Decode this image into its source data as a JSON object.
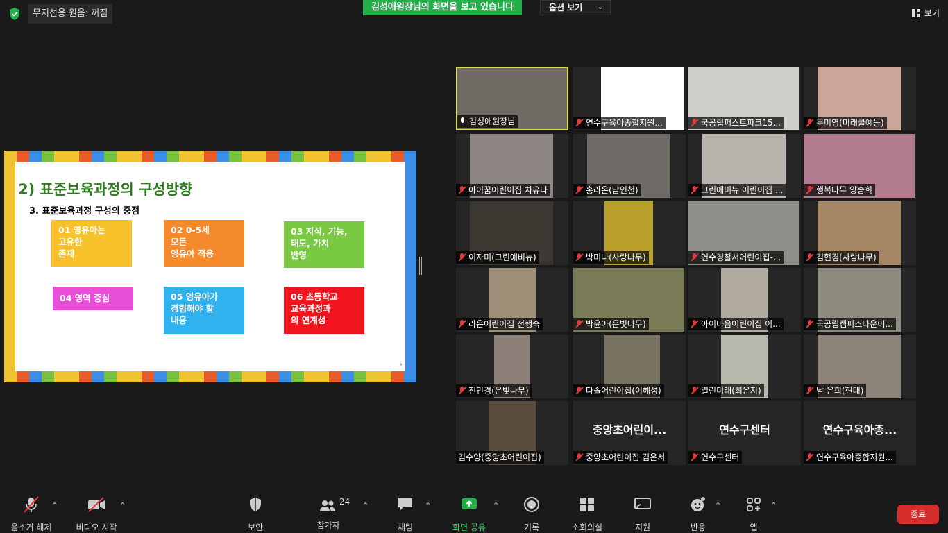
{
  "top": {
    "encryption_badge": "무지선용 원음: 꺼짐",
    "viewing_banner": "김성애원장님의 화면을 보고 있습니다",
    "view_options": "옵션 보기",
    "view_button": "보기"
  },
  "slide": {
    "title": "2) 표준보육과정의 구성방향",
    "subtitle": "3. 표준보육과정 구성의 중점",
    "boxes": [
      {
        "text": "01    영유아는\n         고유한\n         존재",
        "color": "#f6c12a"
      },
      {
        "text": "02      0-5세\n           모든\n      영유아 적용",
        "color": "#f58a2c"
      },
      {
        "text": "03  지식, 기능,\n       태도, 가치\n           반영",
        "color": "#7ac943"
      },
      {
        "text": "04   영역 중심",
        "color": "#e84fd8"
      },
      {
        "text": "05    영유아가\n      경험해야 할\n          내용",
        "color": "#2fb2ee"
      },
      {
        "text": "06   초등학교\n       교육과정과\n       의 연계성",
        "color": "#f0141e"
      }
    ]
  },
  "participants": [
    {
      "name": "김성애원장님",
      "mic": "on",
      "active": true,
      "bg": "#6f6a63"
    },
    {
      "name": "연수구육아종합지원...",
      "mic": "off",
      "bg": "#ffffff"
    },
    {
      "name": "국공립퍼스트파크15...",
      "mic": "off",
      "bg": "#cfcfcb"
    },
    {
      "name": "문미영(미래클예능)",
      "mic": "off",
      "bg": "#c9a59a"
    },
    {
      "name": "아이꿈어린이집 차유나",
      "mic": "off",
      "bg": "#8c8583"
    },
    {
      "name": "홍라온(남인천)",
      "mic": "off",
      "bg": "#6e6a66"
    },
    {
      "name": "그린애비뉴 어린이집 ...",
      "mic": "off",
      "bg": "#b9b4ad"
    },
    {
      "name": "행복나무 양승희",
      "mic": "off",
      "bg": "#b27b8f"
    },
    {
      "name": "이자미(그린애비뉴)",
      "mic": "off",
      "bg": "#3b3731"
    },
    {
      "name": "박미나(사랑나무)",
      "mic": "off",
      "bg": "#b8a02a"
    },
    {
      "name": "연수경찰서어린이집-...",
      "mic": "off",
      "bg": "#8e8f88"
    },
    {
      "name": "김현경(사랑나무)",
      "mic": "off",
      "bg": "#a58766"
    },
    {
      "name": "라온어린이집 전행숙",
      "mic": "off",
      "bg": "#9c8e77"
    },
    {
      "name": "박윤아(은빛나무)",
      "mic": "off",
      "bg": "#7a7c58"
    },
    {
      "name": "아이마음어린이집 이...",
      "mic": "off",
      "bg": "#b0a99d"
    },
    {
      "name": "국공립캠퍼스타운어...",
      "mic": "off",
      "bg": "#8d8b7d"
    },
    {
      "name": "전민경(은빛나무)",
      "mic": "off",
      "bg": "#8d8079"
    },
    {
      "name": "다솔어린이집(이혜성)",
      "mic": "off",
      "bg": "#77725f"
    },
    {
      "name": "열린미래(최은지)",
      "mic": "off",
      "bg": "#b6b9ad"
    },
    {
      "name": "남 은희(현대)",
      "mic": "off",
      "bg": "#8b8377"
    },
    {
      "name": "김수양(중앙초어린이집)",
      "mic": "none",
      "bg": "#5a4c3c"
    },
    {
      "name": "중앙초어린이집 김은서",
      "mic": "off",
      "display": "중앙초어린이..."
    },
    {
      "name": "연수구센터",
      "mic": "off",
      "display": "연수구센터"
    },
    {
      "name": "연수구육아종합지원...",
      "mic": "off",
      "display": "연수구육아종..."
    }
  ],
  "toolbar": {
    "unmute": "음소거 해제",
    "start_video": "비디오 시작",
    "security": "보안",
    "participants": "참가자",
    "participant_count": "24",
    "chat": "채팅",
    "share": "화면 공유",
    "record": "기록",
    "breakout": "소회의실",
    "support": "지원",
    "reactions": "반응",
    "apps": "앱",
    "end": "종료"
  },
  "colors": {
    "active_speaker": "#d8e04a",
    "share_green": "#23b04a",
    "end_red": "#d62c2c",
    "mic_off_red": "#e23b3b"
  }
}
